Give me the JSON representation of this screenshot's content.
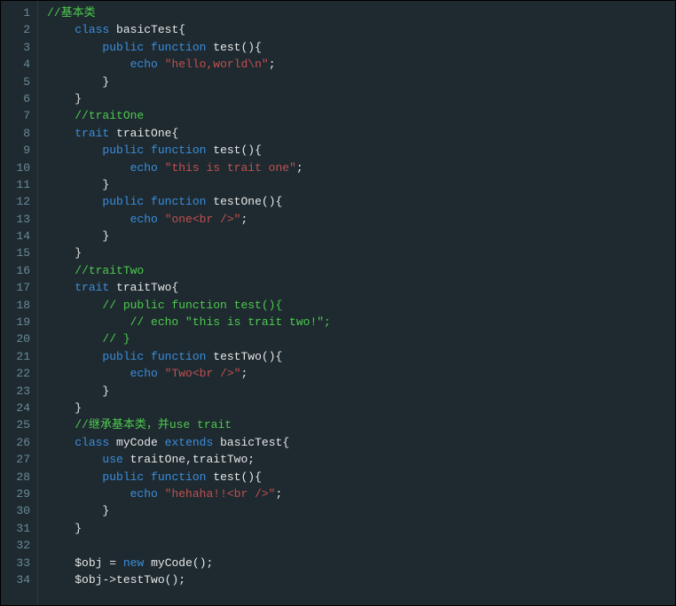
{
  "code": {
    "lines": [
      [
        {
          "t": "comment",
          "v": "//基本类"
        }
      ],
      [
        {
          "t": "plain",
          "v": "    "
        },
        {
          "t": "keyword",
          "v": "class"
        },
        {
          "t": "plain",
          "v": " "
        },
        {
          "t": "ident",
          "v": "basicTest"
        },
        {
          "t": "punc",
          "v": "{"
        }
      ],
      [
        {
          "t": "plain",
          "v": "        "
        },
        {
          "t": "keyword",
          "v": "public"
        },
        {
          "t": "plain",
          "v": " "
        },
        {
          "t": "keyword",
          "v": "function"
        },
        {
          "t": "plain",
          "v": " "
        },
        {
          "t": "func",
          "v": "test"
        },
        {
          "t": "punc",
          "v": "(){"
        }
      ],
      [
        {
          "t": "plain",
          "v": "            "
        },
        {
          "t": "keyword",
          "v": "echo"
        },
        {
          "t": "plain",
          "v": " "
        },
        {
          "t": "string",
          "v": "\"hello,world\\n\""
        },
        {
          "t": "punc",
          "v": ";"
        }
      ],
      [
        {
          "t": "plain",
          "v": "        "
        },
        {
          "t": "punc",
          "v": "}"
        }
      ],
      [
        {
          "t": "plain",
          "v": "    "
        },
        {
          "t": "punc",
          "v": "}"
        }
      ],
      [
        {
          "t": "plain",
          "v": "    "
        },
        {
          "t": "comment",
          "v": "//traitOne"
        }
      ],
      [
        {
          "t": "plain",
          "v": "    "
        },
        {
          "t": "keyword",
          "v": "trait"
        },
        {
          "t": "plain",
          "v": " "
        },
        {
          "t": "ident",
          "v": "traitOne"
        },
        {
          "t": "punc",
          "v": "{"
        }
      ],
      [
        {
          "t": "plain",
          "v": "        "
        },
        {
          "t": "keyword",
          "v": "public"
        },
        {
          "t": "plain",
          "v": " "
        },
        {
          "t": "keyword",
          "v": "function"
        },
        {
          "t": "plain",
          "v": " "
        },
        {
          "t": "func",
          "v": "test"
        },
        {
          "t": "punc",
          "v": "(){"
        }
      ],
      [
        {
          "t": "plain",
          "v": "            "
        },
        {
          "t": "keyword",
          "v": "echo"
        },
        {
          "t": "plain",
          "v": " "
        },
        {
          "t": "string",
          "v": "\"this is trait one\""
        },
        {
          "t": "punc",
          "v": ";"
        }
      ],
      [
        {
          "t": "plain",
          "v": "        "
        },
        {
          "t": "punc",
          "v": "}"
        }
      ],
      [
        {
          "t": "plain",
          "v": "        "
        },
        {
          "t": "keyword",
          "v": "public"
        },
        {
          "t": "plain",
          "v": " "
        },
        {
          "t": "keyword",
          "v": "function"
        },
        {
          "t": "plain",
          "v": " "
        },
        {
          "t": "func",
          "v": "testOne"
        },
        {
          "t": "punc",
          "v": "(){"
        }
      ],
      [
        {
          "t": "plain",
          "v": "            "
        },
        {
          "t": "keyword",
          "v": "echo"
        },
        {
          "t": "plain",
          "v": " "
        },
        {
          "t": "string",
          "v": "\"one<br />\""
        },
        {
          "t": "punc",
          "v": ";"
        }
      ],
      [
        {
          "t": "plain",
          "v": "        "
        },
        {
          "t": "punc",
          "v": "}"
        }
      ],
      [
        {
          "t": "plain",
          "v": "    "
        },
        {
          "t": "punc",
          "v": "}"
        }
      ],
      [
        {
          "t": "plain",
          "v": "    "
        },
        {
          "t": "comment",
          "v": "//traitTwo"
        }
      ],
      [
        {
          "t": "plain",
          "v": "    "
        },
        {
          "t": "keyword",
          "v": "trait"
        },
        {
          "t": "plain",
          "v": " "
        },
        {
          "t": "ident",
          "v": "traitTwo"
        },
        {
          "t": "punc",
          "v": "{"
        }
      ],
      [
        {
          "t": "plain",
          "v": "        "
        },
        {
          "t": "comment",
          "v": "// public function test(){"
        }
      ],
      [
        {
          "t": "plain",
          "v": "            "
        },
        {
          "t": "comment",
          "v": "// echo \"this is trait two!\";"
        }
      ],
      [
        {
          "t": "plain",
          "v": "        "
        },
        {
          "t": "comment",
          "v": "// }"
        }
      ],
      [
        {
          "t": "plain",
          "v": "        "
        },
        {
          "t": "keyword",
          "v": "public"
        },
        {
          "t": "plain",
          "v": " "
        },
        {
          "t": "keyword",
          "v": "function"
        },
        {
          "t": "plain",
          "v": " "
        },
        {
          "t": "func",
          "v": "testTwo"
        },
        {
          "t": "punc",
          "v": "(){"
        }
      ],
      [
        {
          "t": "plain",
          "v": "            "
        },
        {
          "t": "keyword",
          "v": "echo"
        },
        {
          "t": "plain",
          "v": " "
        },
        {
          "t": "string",
          "v": "\"Two<br />\""
        },
        {
          "t": "punc",
          "v": ";"
        }
      ],
      [
        {
          "t": "plain",
          "v": "        "
        },
        {
          "t": "punc",
          "v": "}"
        }
      ],
      [
        {
          "t": "plain",
          "v": "    "
        },
        {
          "t": "punc",
          "v": "}"
        }
      ],
      [
        {
          "t": "plain",
          "v": "    "
        },
        {
          "t": "comment",
          "v": "//继承基本类，并use trait"
        }
      ],
      [
        {
          "t": "plain",
          "v": "    "
        },
        {
          "t": "keyword",
          "v": "class"
        },
        {
          "t": "plain",
          "v": " "
        },
        {
          "t": "ident",
          "v": "myCode"
        },
        {
          "t": "plain",
          "v": " "
        },
        {
          "t": "keyword",
          "v": "extends"
        },
        {
          "t": "plain",
          "v": " "
        },
        {
          "t": "ident",
          "v": "basicTest"
        },
        {
          "t": "punc",
          "v": "{"
        }
      ],
      [
        {
          "t": "plain",
          "v": "        "
        },
        {
          "t": "keyword",
          "v": "use"
        },
        {
          "t": "plain",
          "v": " "
        },
        {
          "t": "ident",
          "v": "traitOne"
        },
        {
          "t": "punc",
          "v": ","
        },
        {
          "t": "ident",
          "v": "traitTwo"
        },
        {
          "t": "punc",
          "v": ";"
        }
      ],
      [
        {
          "t": "plain",
          "v": "        "
        },
        {
          "t": "keyword",
          "v": "public"
        },
        {
          "t": "plain",
          "v": " "
        },
        {
          "t": "keyword",
          "v": "function"
        },
        {
          "t": "plain",
          "v": " "
        },
        {
          "t": "func",
          "v": "test"
        },
        {
          "t": "punc",
          "v": "(){"
        }
      ],
      [
        {
          "t": "plain",
          "v": "            "
        },
        {
          "t": "keyword",
          "v": "echo"
        },
        {
          "t": "plain",
          "v": " "
        },
        {
          "t": "string",
          "v": "\"hehaha!!<br />\""
        },
        {
          "t": "punc",
          "v": ";"
        }
      ],
      [
        {
          "t": "plain",
          "v": "        "
        },
        {
          "t": "punc",
          "v": "}"
        }
      ],
      [
        {
          "t": "plain",
          "v": "    "
        },
        {
          "t": "punc",
          "v": "}"
        }
      ],
      [],
      [
        {
          "t": "plain",
          "v": "    "
        },
        {
          "t": "var",
          "v": "$obj"
        },
        {
          "t": "plain",
          "v": " "
        },
        {
          "t": "punc",
          "v": "="
        },
        {
          "t": "plain",
          "v": " "
        },
        {
          "t": "keyword",
          "v": "new"
        },
        {
          "t": "plain",
          "v": " "
        },
        {
          "t": "ident",
          "v": "myCode"
        },
        {
          "t": "punc",
          "v": "();"
        }
      ],
      [
        {
          "t": "plain",
          "v": "    "
        },
        {
          "t": "var",
          "v": "$obj"
        },
        {
          "t": "punc",
          "v": "->"
        },
        {
          "t": "func",
          "v": "testTwo"
        },
        {
          "t": "punc",
          "v": "();"
        }
      ]
    ]
  }
}
